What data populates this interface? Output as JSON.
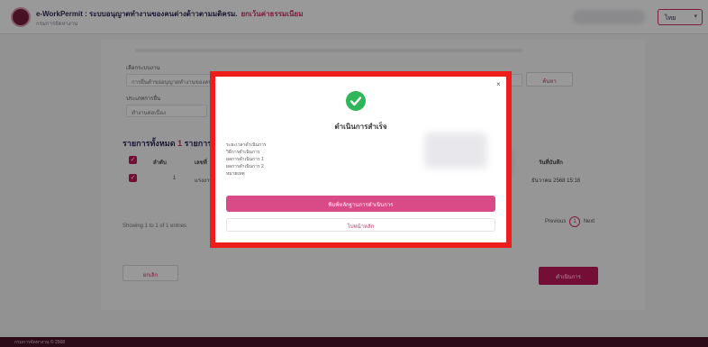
{
  "header": {
    "app_title": "e-WorkPermit : ระบบอนุญาตทำงานของคนต่างด้าวตามมติครม.",
    "title_tag": "ยกเว้นค่าธรรมเนียม",
    "app_subtitle": "กรมการจัดหางาน",
    "language": "ไทย"
  },
  "form": {
    "label_1": "เลือกระบบงาน",
    "field_1": "การยื่นคำขออนุญาตทำงานของคนต่างด้าว",
    "label_2": "ประเภทการยื่น",
    "field_2": "ทำงานต่อเนื่อง",
    "search_button": "ค้นหา"
  },
  "list": {
    "title_prefix": "รายการทั้งหมด",
    "count": "1",
    "title_suffix": "รายการ",
    "headers": [
      "ลำดับ",
      "เลขที่",
      "วันที่บันทึก"
    ],
    "row": {
      "index": "1",
      "code": "แรงงาน...",
      "date": "ธันวาคม 2568 15:16"
    },
    "showing": "Showing 1 to 1 of 1 entries",
    "prev": "Previous",
    "page": "1",
    "next": "Next",
    "back_button": "ยกเลิก",
    "proceed_button": "ดำเนินการ"
  },
  "modal": {
    "title": "ดำเนินการสำเร็จ",
    "info_lines": [
      "ระยะเวลาดำเนินการ",
      "วิธีการดำเนินการ",
      "ผลการดำเนินการ 1",
      "ผลการดำเนินการ 2",
      "หมายเหตุ"
    ],
    "print_button": "พิมพ์หลักฐานการดำเนินการ",
    "alt_button": "ไปหน้าหลัก"
  },
  "footer": {
    "text": "กรมการจัดหางาน © 2568"
  },
  "colors": {
    "accent": "#c2185b",
    "highlight_border": "#ef1c1c",
    "success": "#2fb55a",
    "footer_bg": "#4a1528"
  }
}
